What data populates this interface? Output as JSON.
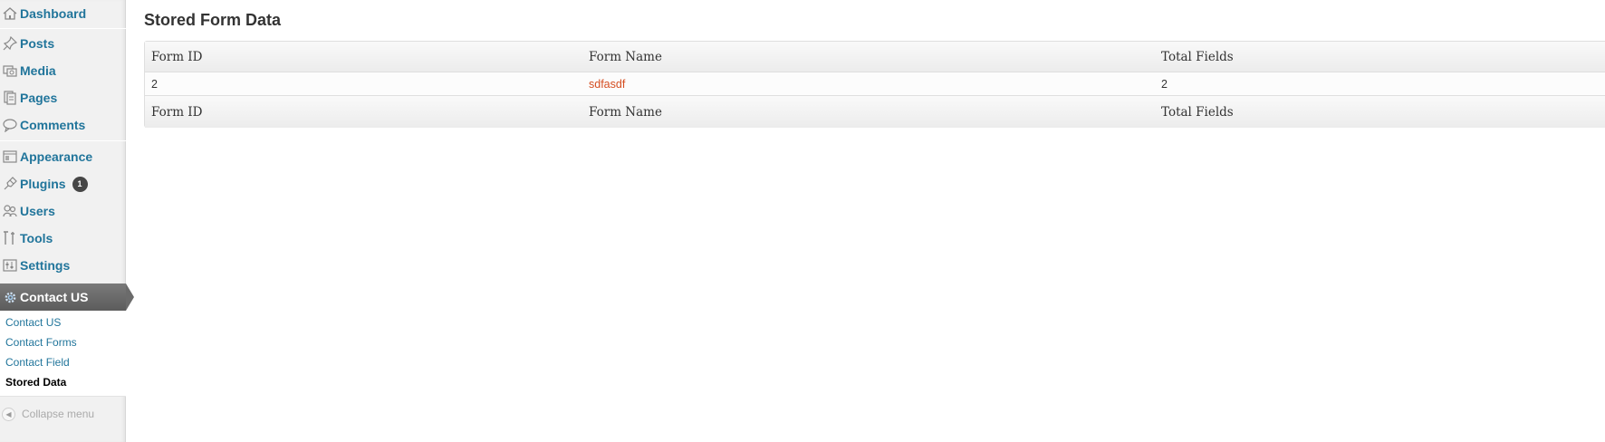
{
  "sidebar": {
    "items": [
      {
        "label": "Dashboard",
        "icon": "dashboard-icon"
      },
      {
        "label": "Posts",
        "icon": "pushpin-icon"
      },
      {
        "label": "Media",
        "icon": "media-icon"
      },
      {
        "label": "Pages",
        "icon": "pages-icon"
      },
      {
        "label": "Comments",
        "icon": "comment-icon"
      },
      {
        "label": "Appearance",
        "icon": "appearance-icon"
      },
      {
        "label": "Plugins",
        "icon": "plug-icon",
        "badge": "1"
      },
      {
        "label": "Users",
        "icon": "users-icon"
      },
      {
        "label": "Tools",
        "icon": "tools-icon"
      },
      {
        "label": "Settings",
        "icon": "settings-icon"
      }
    ],
    "active": {
      "label": "Contact US",
      "icon": "gear-icon"
    },
    "submenu": [
      {
        "label": "Contact US"
      },
      {
        "label": "Contact Forms"
      },
      {
        "label": "Contact Field"
      },
      {
        "label": "Stored Data",
        "current": true
      }
    ],
    "collapse_label": "Collapse menu"
  },
  "main": {
    "title": "Stored Form Data",
    "table": {
      "columns": [
        "Form ID",
        "Form Name",
        "Total Fields"
      ],
      "rows": [
        {
          "form_id": "2",
          "form_name": "sdfasdf",
          "total_fields": "2"
        }
      ],
      "footer_columns": [
        "Form ID",
        "Form Name",
        "Total Fields"
      ]
    }
  },
  "colors": {
    "link": "#21759b",
    "accent_link": "#d54e21",
    "active_menu": "#6b6b6b"
  }
}
